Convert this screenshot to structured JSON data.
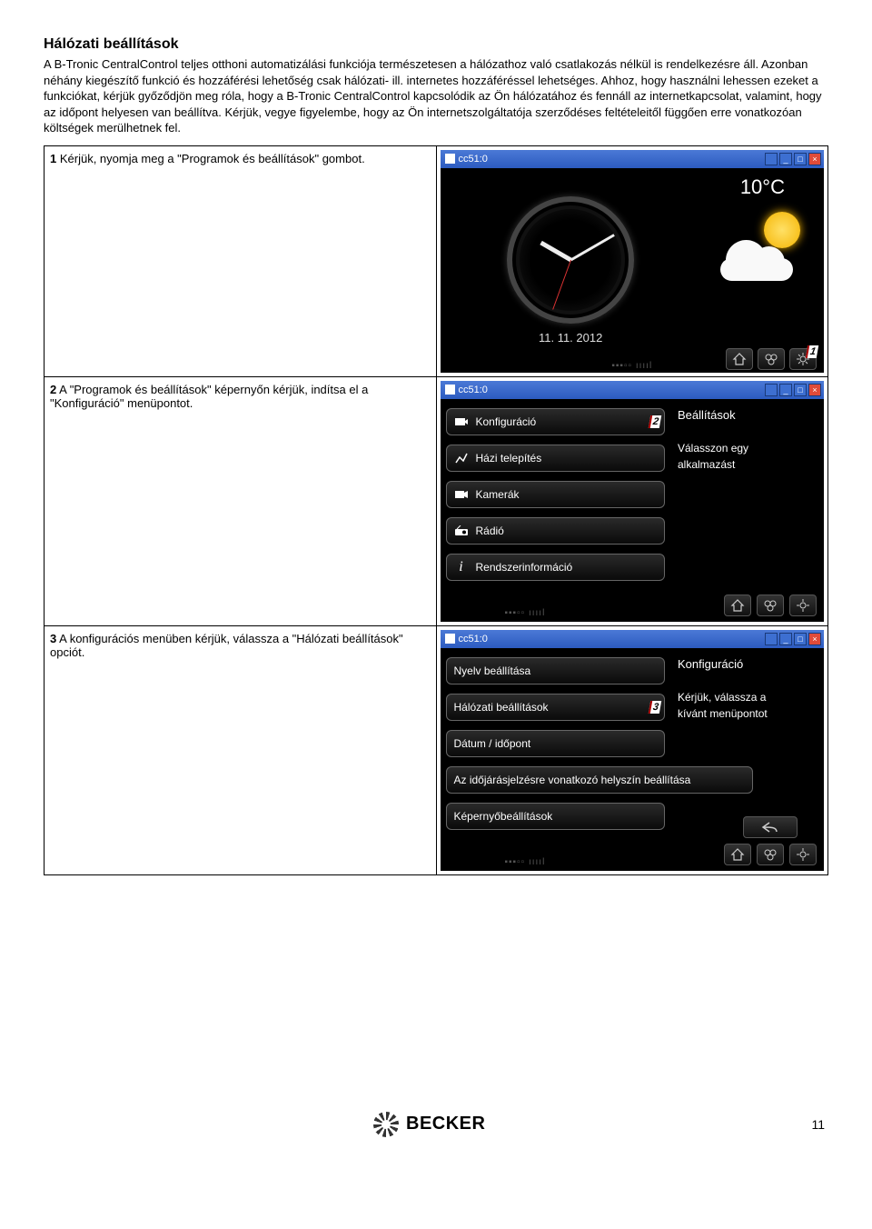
{
  "page": {
    "title": "Hálózati beállítások",
    "intro": "A B-Tronic CentralControl teljes otthoni automatizálási funkciója természetesen a hálózathoz való csatlakozás nélkül is rendelkezésre áll. Azonban néhány kiegészítő funkció és hozzáférési lehetőség csak hálózati- ill. internetes hozzáféréssel lehetséges. Ahhoz, hogy használni lehessen ezeket a funkciókat, kérjük győződjön meg róla, hogy a B-Tronic CentralControl kapcsolódik az Ön hálózatához és fennáll az internetkapcsolat, valamint, hogy az időpont helyesen van beállítva. Kérjük, vegye figyelembe, hogy az Ön internetszolgáltatója szerződéses feltételeitől függően erre vonatkozóan költségek merülhetnek fel.",
    "number": "11"
  },
  "steps": {
    "s1": {
      "num": "1",
      "text": " Kérjük, nyomja meg a \"Programok és beállítások\" gombot."
    },
    "s2": {
      "num": "2",
      "text": " A \"Programok és beállítások\" képernyőn kérjük, indítsa el a \"Konfiguráció\" menüpontot."
    },
    "s3": {
      "num": "3",
      "text": " A konfigurációs menüben kérjük, válassza a \"Hálózati beállítások\" opciót."
    }
  },
  "titlebar": {
    "caption": "cc51:0"
  },
  "home": {
    "temperature": "10°C",
    "date": "11. 11. 2012",
    "marker": "1"
  },
  "menu2": {
    "items": {
      "config": "Konfiguráció",
      "install": "Házi telepítés",
      "cameras": "Kamerák",
      "radio": "Rádió",
      "sysinfo": "Rendszerinformáció"
    },
    "side_title": "Beállítások",
    "side_text1": "Válasszon egy",
    "side_text2": "alkalmazást",
    "marker": "2"
  },
  "menu3": {
    "items": {
      "lang": "Nyelv beállítása",
      "net": "Hálózati beállítások",
      "datetime": "Dátum / időpont",
      "weather": "Az időjárásjelzésre vonatkozó helyszín beállítása",
      "screen": "Képernyőbeállítások"
    },
    "side_title": "Konfiguráció",
    "side_text1": "Kérjük, válassza a",
    "side_text2": "kívánt menüpontot",
    "marker": "3"
  },
  "logo": "BECKER"
}
